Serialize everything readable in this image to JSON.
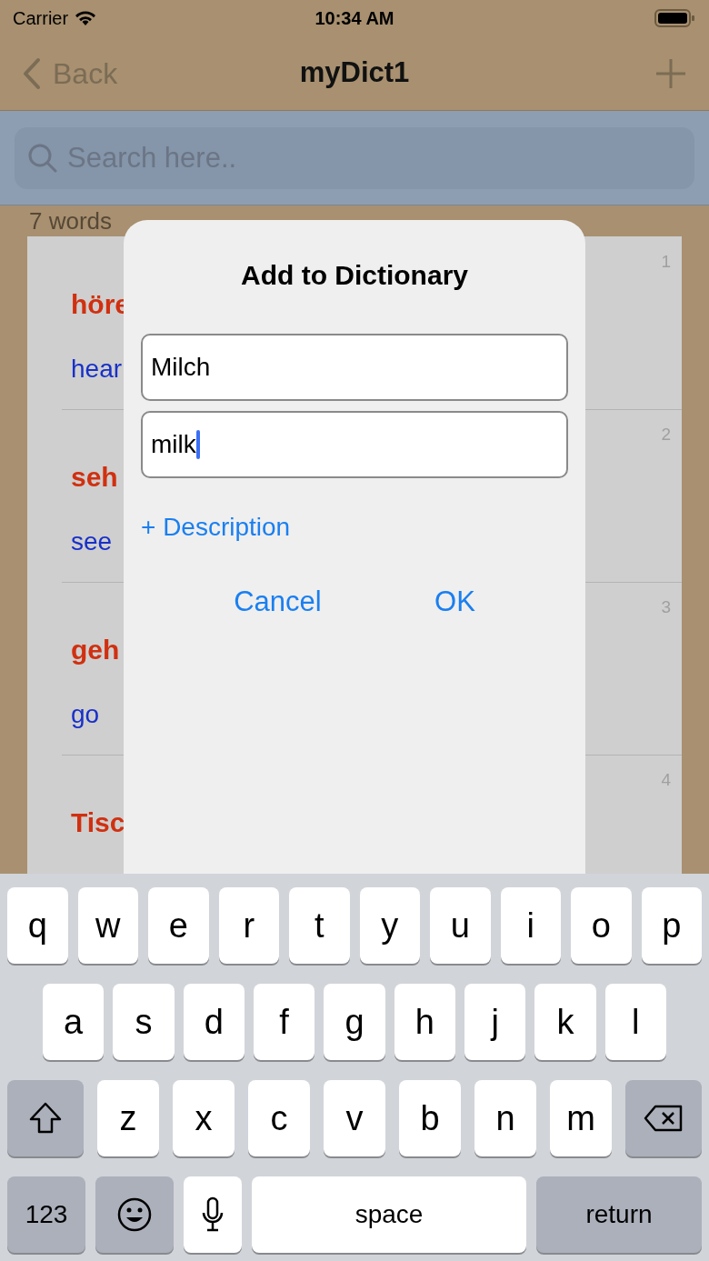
{
  "status_bar": {
    "carrier": "Carrier",
    "time": "10:34 AM"
  },
  "nav_bar": {
    "back": "Back",
    "title": "myDict1"
  },
  "search": {
    "placeholder": "Search here.."
  },
  "word_count": "7 words",
  "entries": [
    {
      "word": "höre",
      "translation": "hear",
      "number": "1"
    },
    {
      "word": "seh",
      "translation": "see",
      "number": "2"
    },
    {
      "word": "geh",
      "translation": "go",
      "number": "3"
    },
    {
      "word": "Tisc",
      "number": "4"
    }
  ],
  "dialog": {
    "title": "Add to Dictionary",
    "fields": [
      {
        "value": "Milch",
        "focused": false
      },
      {
        "value": "milk",
        "focused": true
      }
    ],
    "description_link": "+ Description",
    "buttons": [
      "Cancel",
      "OK"
    ]
  },
  "keyboard": {
    "rows": [
      {
        "keys": [
          {
            "kind": "letter",
            "label": "q"
          },
          {
            "kind": "letter",
            "label": "w"
          },
          {
            "kind": "letter",
            "label": "e"
          },
          {
            "kind": "letter",
            "label": "r"
          },
          {
            "kind": "letter",
            "label": "t"
          },
          {
            "kind": "letter",
            "label": "y"
          },
          {
            "kind": "letter",
            "label": "u"
          },
          {
            "kind": "letter",
            "label": "i"
          },
          {
            "kind": "letter",
            "label": "o"
          },
          {
            "kind": "letter",
            "label": "p"
          }
        ]
      },
      {
        "keys": [
          {
            "kind": "letter",
            "label": "a"
          },
          {
            "kind": "letter",
            "label": "s"
          },
          {
            "kind": "letter",
            "label": "d"
          },
          {
            "kind": "letter",
            "label": "f"
          },
          {
            "kind": "letter",
            "label": "g"
          },
          {
            "kind": "letter",
            "label": "h"
          },
          {
            "kind": "letter",
            "label": "j"
          },
          {
            "kind": "letter",
            "label": "k"
          },
          {
            "kind": "letter",
            "label": "l"
          }
        ]
      },
      {
        "keys": [
          {
            "kind": "shift"
          },
          {
            "kind": "letter",
            "label": "z"
          },
          {
            "kind": "letter",
            "label": "x"
          },
          {
            "kind": "letter",
            "label": "c"
          },
          {
            "kind": "letter",
            "label": "v"
          },
          {
            "kind": "letter",
            "label": "b"
          },
          {
            "kind": "letter",
            "label": "n"
          },
          {
            "kind": "letter",
            "label": "m"
          },
          {
            "kind": "delete"
          }
        ]
      },
      {
        "keys": [
          {
            "kind": "numbers",
            "label": "123"
          },
          {
            "kind": "emoji"
          },
          {
            "kind": "mic"
          },
          {
            "kind": "space",
            "label": "space"
          },
          {
            "kind": "return",
            "label": "return"
          }
        ]
      }
    ]
  }
}
